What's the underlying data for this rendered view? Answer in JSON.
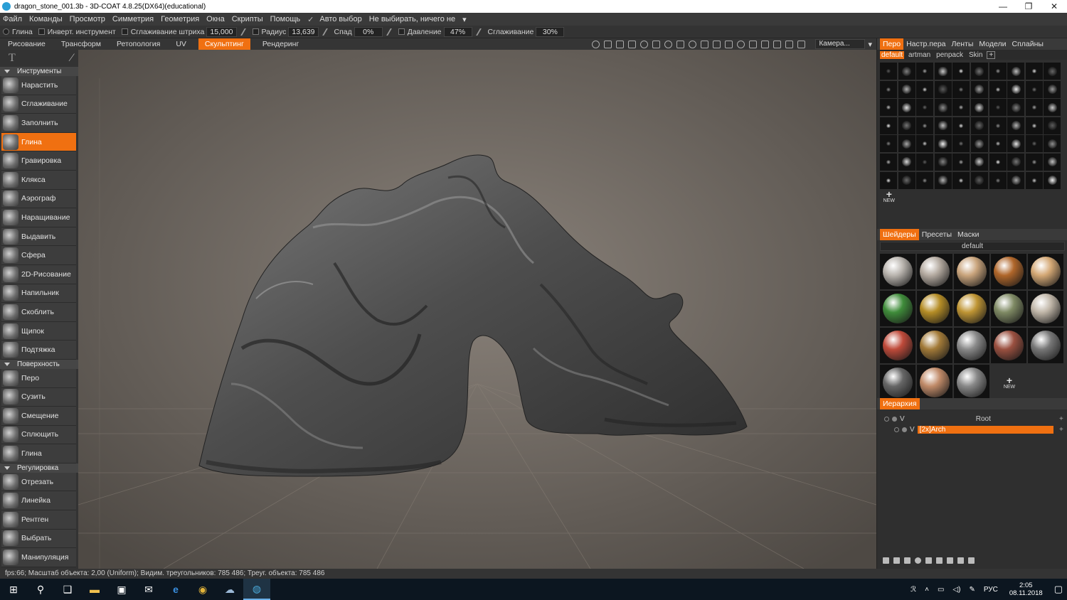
{
  "window": {
    "title": "dragon_stone_001.3b - 3D-COAT 4.8.25(DX64)(educational)",
    "minimize": "—",
    "maximize": "❐",
    "close": "✕"
  },
  "menu": {
    "items": [
      "Файл",
      "Команды",
      "Просмотр",
      "Симметрия",
      "Геометрия",
      "Окна",
      "Скрипты",
      "Помощь"
    ],
    "auto_select": "Авто выбор",
    "no_select": "Не выбирать, ничего  не"
  },
  "options": {
    "clay": "Глина",
    "invert": "Инверт. инструмент",
    "stroke_smooth_label": "Сглаживание штриха",
    "stroke_smooth_value": "15,000",
    "radius_label": "Радиус",
    "radius_value": "13,639",
    "falloff_label": "Спад",
    "falloff_value": "0%",
    "pressure_label": "Давление",
    "pressure_value": "47%",
    "smoothing_label": "Сглаживание",
    "smoothing_value": "30%"
  },
  "rooms": {
    "items": [
      "Рисование",
      "Трансформ",
      "Ретопология",
      "UV",
      "Скульптинг",
      "Рендеринг"
    ],
    "active": "Скульптинг",
    "camera": "Камера..."
  },
  "left_panel": {
    "instruments_header": "Инструменты",
    "instruments": [
      "Нарастить",
      "Сглаживание",
      "Заполнить",
      "Глина",
      "Гравировка",
      "Клякса",
      "Аэрограф",
      "Наращивание",
      "Выдавить",
      "Сфера",
      "2D-Рисование",
      "Напильник",
      "Скоблить",
      "Щипок",
      "Подтяжка"
    ],
    "active_tool": "Глина",
    "surface_header": "Поверхность",
    "surface": [
      "Перо",
      "Сузить",
      "Смещение",
      "Сплющить",
      "Глина"
    ],
    "adjust_header": "Регулировка",
    "adjust": [
      "Отрезать",
      "Линейка",
      "Рентген",
      "Выбрать",
      "Манипуляция"
    ]
  },
  "right_panel": {
    "tabs": [
      "Перо",
      "Настр.пера",
      "Ленты",
      "Модели",
      "Сплайны"
    ],
    "active_tab": "Перо",
    "brush_sets": [
      "default",
      "artman",
      "penpack",
      "Skin"
    ],
    "active_brush_set": "default",
    "new_label": "NEW",
    "shader_tabs": [
      "Шейдеры",
      "Пресеты",
      "Маски"
    ],
    "active_shader_tab": "Шейдеры",
    "shader_set": "default",
    "shader_colors": [
      "#b9b4ae",
      "#b4aaa0",
      "#c9a47c",
      "#b0662a",
      "#d4a875",
      "#3f8c3a",
      "#b58d26",
      "#bf9534",
      "#7f8a64",
      "#c0b6a8",
      "#bf4a3a",
      "#a27a38",
      "#8a8a8a",
      "#9a5040",
      "#777777",
      "#666666",
      "#c08a68",
      "#888888"
    ],
    "hierarchy_tab": "Иерархия",
    "hierarchy": [
      {
        "name": "Root",
        "flag": "V"
      },
      {
        "name": "[2x]Arch",
        "flag": "V"
      }
    ]
  },
  "status": {
    "text": "fps:66;    Масштаб  объекта: 2,00 (Uniform); Видим. треугольников: 785  486; Треуг. объекта: 785  486"
  },
  "taskbar": {
    "language": "РУС",
    "time": "2:05",
    "date": "08.11.2018"
  }
}
